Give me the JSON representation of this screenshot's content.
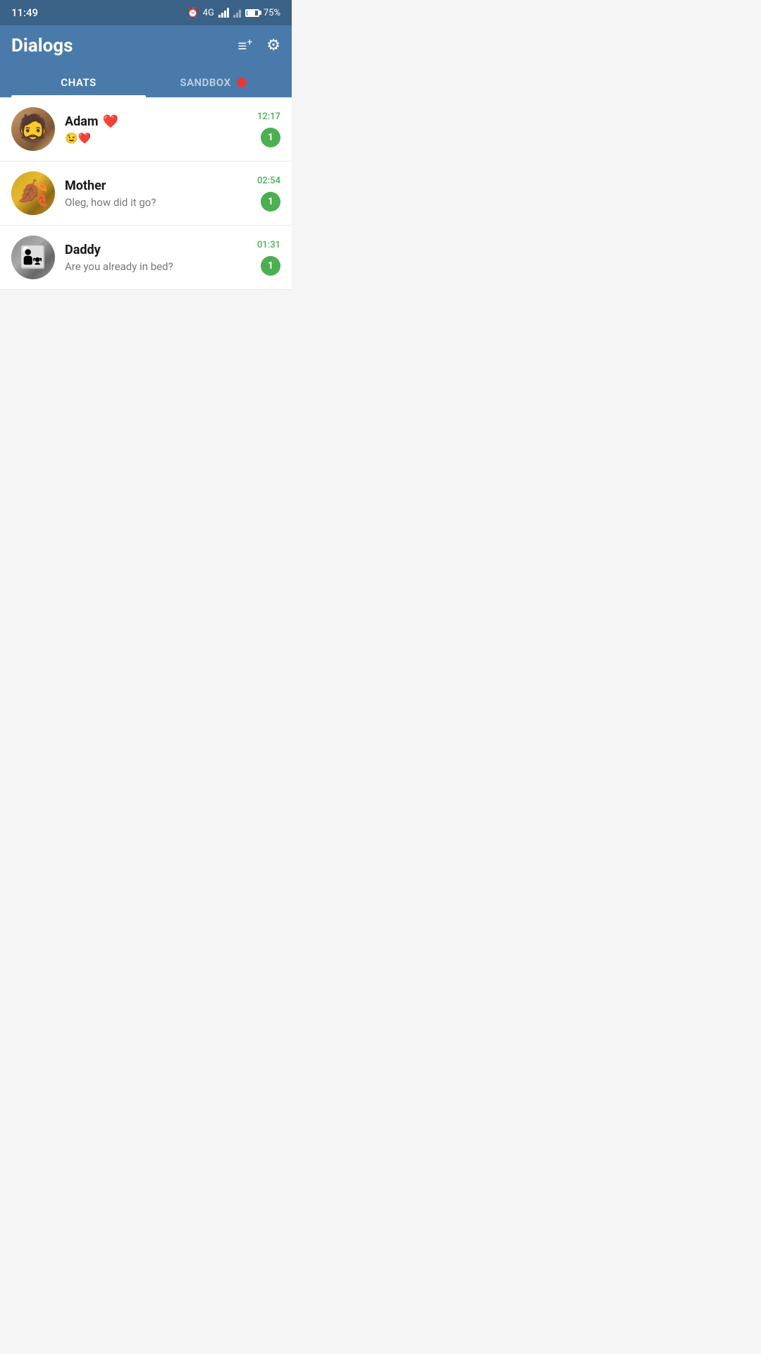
{
  "statusBar": {
    "time": "11:49",
    "network": "4G",
    "battery": "75%"
  },
  "header": {
    "title": "Dialogs",
    "addButton": "add-chat",
    "settingsButton": "settings"
  },
  "tabs": [
    {
      "id": "chats",
      "label": "CHATS",
      "active": true
    },
    {
      "id": "sandbox",
      "label": "SANDBOX",
      "active": false,
      "hasNotification": true
    }
  ],
  "chats": [
    {
      "id": "adam",
      "name": "Adam",
      "nameEmoji": "❤️",
      "preview": "😉❤️",
      "time": "12:17",
      "unread": 1,
      "avatarType": "adam"
    },
    {
      "id": "mother",
      "name": "Mother",
      "preview": "Oleg, how did it go?",
      "time": "02:54",
      "unread": 1,
      "avatarType": "mother"
    },
    {
      "id": "daddy",
      "name": "Daddy",
      "preview": "Are you already in bed?",
      "time": "01:31",
      "unread": 1,
      "avatarType": "daddy"
    }
  ]
}
